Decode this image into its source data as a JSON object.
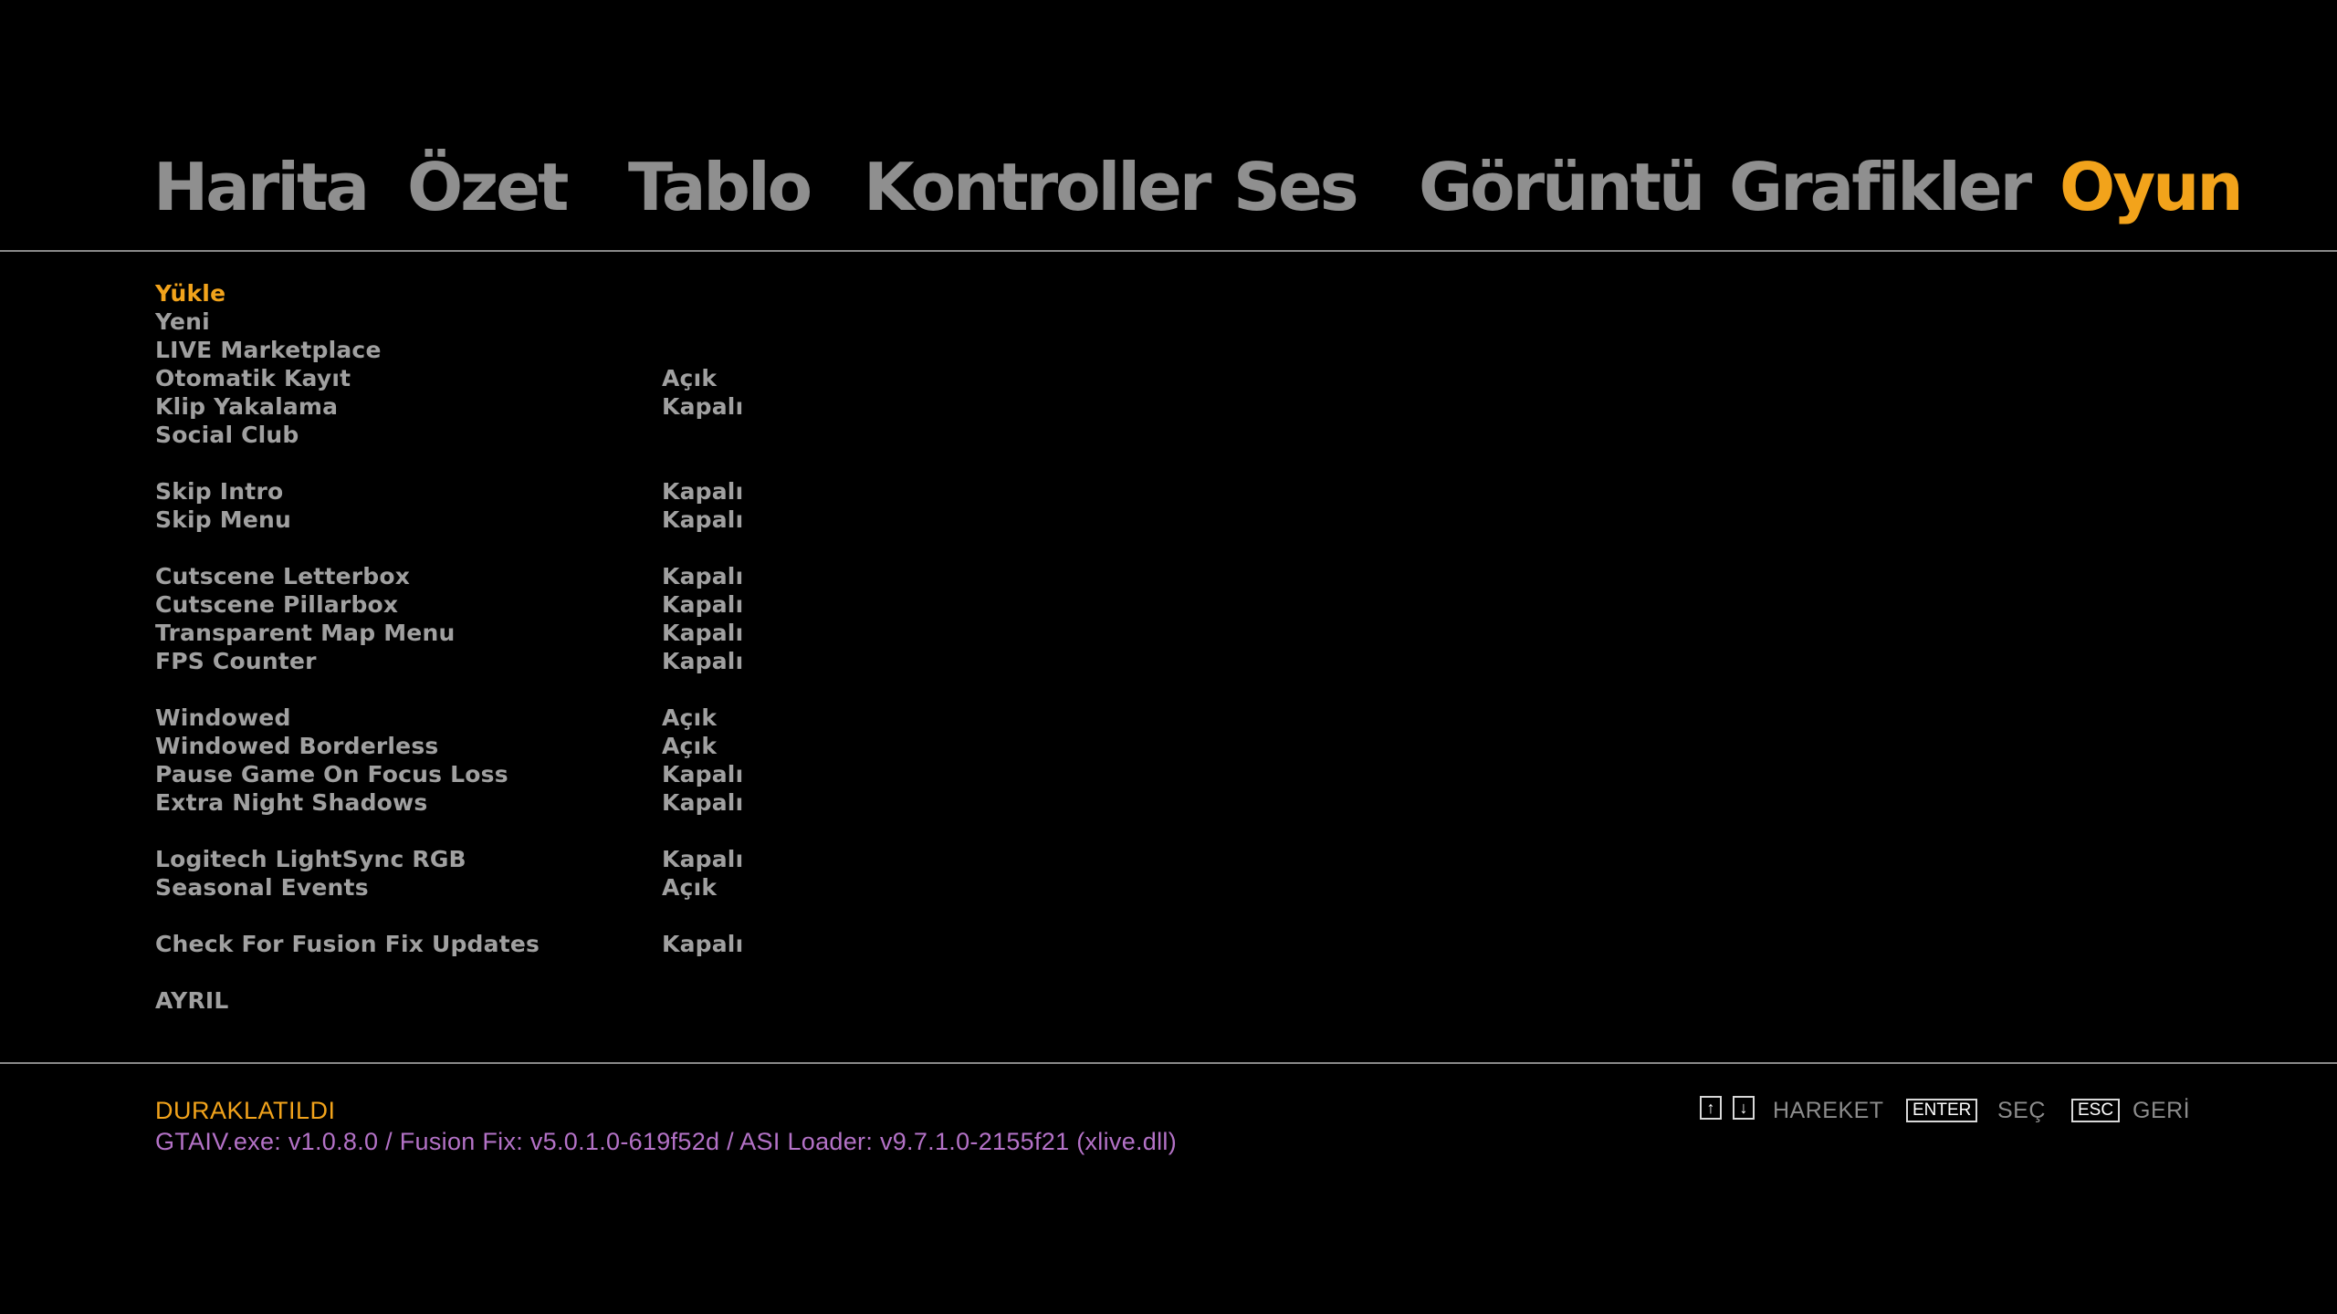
{
  "tabs": [
    {
      "label": "Harita"
    },
    {
      "label": "Özet"
    },
    {
      "label": "Tablo"
    },
    {
      "label": "Kontroller"
    },
    {
      "label": "Ses"
    },
    {
      "label": "Görüntü"
    },
    {
      "label": "Grafikler"
    },
    {
      "label": "Oyun",
      "active": true
    }
  ],
  "menu": {
    "items": [
      {
        "label": "Yükle",
        "value": "",
        "selected": true
      },
      {
        "label": "Yeni",
        "value": ""
      },
      {
        "label": "LIVE Marketplace",
        "value": ""
      },
      {
        "label": "Otomatik Kayıt",
        "value": "Açık"
      },
      {
        "label": "Klip Yakalama",
        "value": "Kapalı"
      },
      {
        "label": "Social Club",
        "value": ""
      },
      {
        "label": "Skip Intro",
        "value": "Kapalı"
      },
      {
        "label": "Skip Menu",
        "value": "Kapalı"
      },
      {
        "label": "Cutscene Letterbox",
        "value": "Kapalı"
      },
      {
        "label": "Cutscene Pillarbox",
        "value": "Kapalı"
      },
      {
        "label": "Transparent Map Menu",
        "value": "Kapalı"
      },
      {
        "label": "FPS Counter",
        "value": "Kapalı"
      },
      {
        "label": "Windowed",
        "value": "Açık"
      },
      {
        "label": "Windowed Borderless",
        "value": "Açık"
      },
      {
        "label": "Pause Game On Focus Loss",
        "value": "Kapalı"
      },
      {
        "label": "Extra Night Shadows",
        "value": "Kapalı"
      },
      {
        "label": "Logitech LightSync RGB",
        "value": "Kapalı"
      },
      {
        "label": "Seasonal Events",
        "value": "Açık"
      },
      {
        "label": "Check For Fusion Fix Updates",
        "value": "Kapalı"
      },
      {
        "label": "AYRIL",
        "value": ""
      }
    ]
  },
  "footer": {
    "status": "DURAKLATILDI",
    "version": "GTAIV.exe: v1.0.8.0 / Fusion Fix: v5.0.1.0-619f52d / ASI Loader: v9.7.1.0-2155f21 (xlive.dll)",
    "hints": {
      "up_icon": "↑",
      "down_icon": "↓",
      "move_label": "HAREKET",
      "enter_key": "ENTER",
      "select_label": "SEÇ",
      "esc_key": "ESC",
      "back_label": "GERİ"
    }
  },
  "colors": {
    "accent": "#f2a31b",
    "text": "#a0a0a0",
    "tab_inactive": "#8f8f8f",
    "version": "#b472c7",
    "background": "#000000"
  }
}
